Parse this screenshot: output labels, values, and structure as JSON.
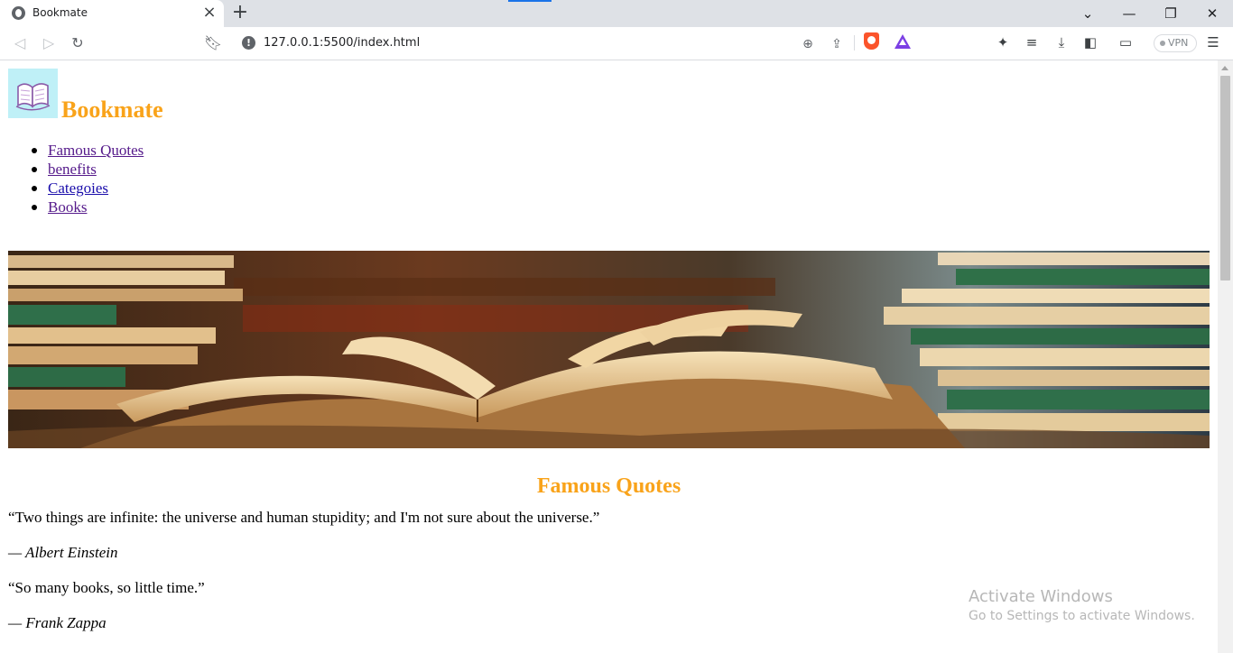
{
  "tab": {
    "title": "Bookmate"
  },
  "address_bar": {
    "url": "127.0.0.1:5500/index.html"
  },
  "toolbar": {
    "vpn_label": "VPN"
  },
  "page": {
    "brand": "Bookmate",
    "nav_items": [
      {
        "label": "Famous Quotes",
        "visited": true
      },
      {
        "label": "benefits",
        "visited": true
      },
      {
        "label": "Categoies",
        "visited": false
      },
      {
        "label": "Books",
        "visited": true
      }
    ],
    "section_title": "Famous Quotes",
    "quotes": [
      {
        "text": "“Two things are infinite: the universe and human stupidity; and I'm not sure about the universe.”",
        "author": "— Albert Einstein"
      },
      {
        "text": "“So many books, so little time.”",
        "author": "— Frank Zappa"
      }
    ]
  },
  "watermark": {
    "line1": "Activate Windows",
    "line2": "Go to Settings to activate Windows."
  },
  "colors": {
    "brand": "#f9a31a",
    "link": "#1a0dab",
    "link_visited": "#551a8b"
  }
}
